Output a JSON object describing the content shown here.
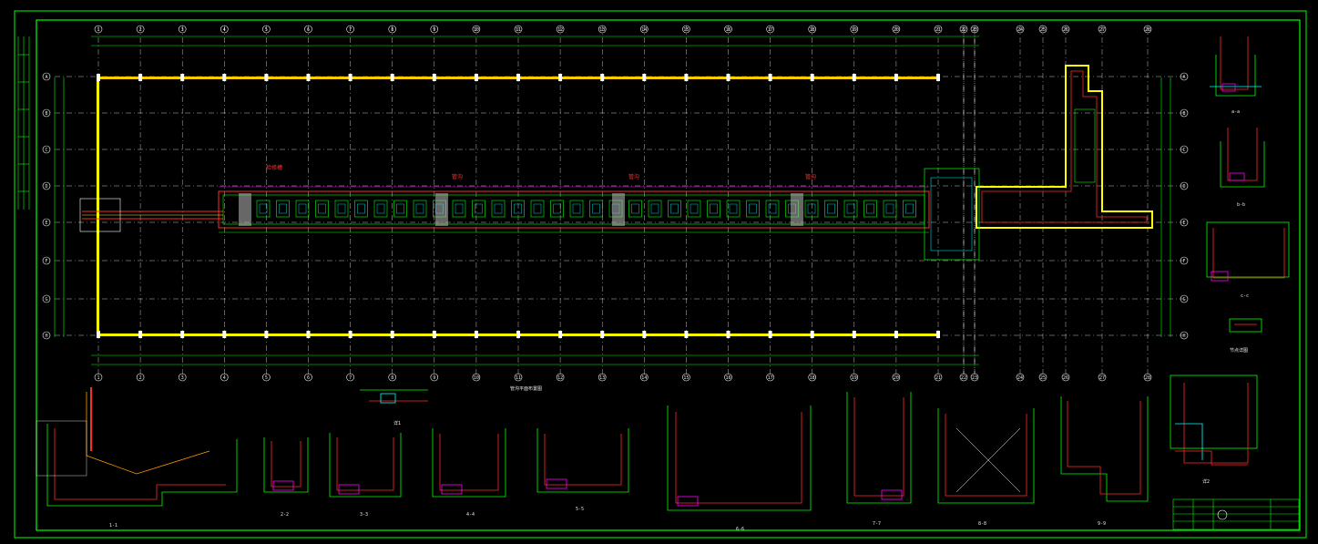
{
  "drawing": {
    "background": "#000000",
    "colors": {
      "frame": "#00ff00",
      "grid": "#ffffff",
      "dim": "#00ff00",
      "wall_red": "#ff2a2a",
      "wall_yellow": "#ffff00",
      "axis_label": "#ffffff",
      "cyan": "#00ffff",
      "magenta": "#ff00ff",
      "orange": "#ff9900"
    },
    "grid_axes_top": [
      "1",
      "2",
      "3",
      "4",
      "5",
      "6",
      "7",
      "8",
      "9",
      "10",
      "11",
      "12",
      "13",
      "14",
      "15",
      "16",
      "17",
      "18",
      "19",
      "20",
      "21",
      "22",
      "23",
      "24",
      "25",
      "26",
      "27",
      "28",
      "29",
      "30",
      "31",
      "32",
      "33"
    ],
    "grid_axes_left": [
      "A",
      "B",
      "C",
      "D",
      "E",
      "F",
      "G",
      "H"
    ],
    "plan_annotations": [
      "检修槽",
      "管沟",
      "管沟",
      "管沟"
    ],
    "plan_title": "管沟平面布置图",
    "sections": [
      {
        "id": "sec-1",
        "label": "1-1"
      },
      {
        "id": "sec-2",
        "label": "2-2"
      },
      {
        "id": "sec-3",
        "label": "3-3"
      },
      {
        "id": "sec-4",
        "label": "4-4"
      },
      {
        "id": "sec-5",
        "label": "5-5"
      },
      {
        "id": "sec-6",
        "label": "6-6"
      },
      {
        "id": "sec-7",
        "label": "7-7"
      },
      {
        "id": "sec-8",
        "label": "8-8"
      },
      {
        "id": "sec-9",
        "label": "9-9"
      },
      {
        "id": "sec-10",
        "label": "详1"
      },
      {
        "id": "sec-11",
        "label": "详2"
      }
    ],
    "right_details": [
      "a-a",
      "b-b",
      "c-c",
      "节点详图"
    ],
    "title_block": {
      "project": "",
      "drawing_name": "",
      "sheet_no": ""
    }
  }
}
